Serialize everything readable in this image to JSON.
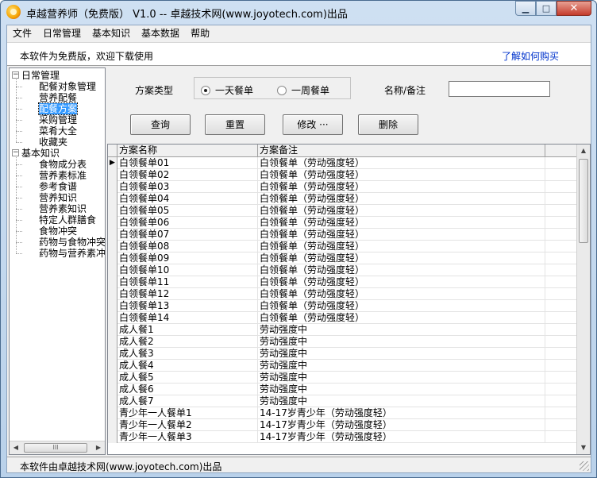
{
  "window": {
    "title": "卓越营养师（免费版） V1.0 -- 卓越技术网(www.joyotech.com)出品"
  },
  "menu": [
    "文件",
    "日常管理",
    "基本知识",
    "基本数据",
    "帮助"
  ],
  "infobar": {
    "left_text": "本软件为免费版，欢迎下载使用",
    "link_text": "了解如何购买"
  },
  "tree": {
    "group1": {
      "label": "日常管理",
      "expander": "−",
      "items": [
        "配餐对象管理",
        "营养配餐",
        "配餐方案",
        "采购管理",
        "菜肴大全",
        "收藏夹"
      ]
    },
    "group2": {
      "label": "基本知识",
      "expander": "−",
      "items": [
        "食物成分表",
        "营养素标准",
        "参考食谱",
        "营养知识",
        "营养素知识",
        "特定人群膳食",
        "食物冲突",
        "药物与食物冲突",
        "药物与营养素冲突"
      ]
    },
    "selected": "配餐方案",
    "hscroll_thumb": "III"
  },
  "form": {
    "plan_type_label": "方案类型",
    "radio_day": "一天餐单",
    "radio_week": "一周餐单",
    "radio_selected": "day",
    "name_label": "名称/备注",
    "name_value": "",
    "buttons": {
      "query": "查询",
      "reset": "重置",
      "edit": "修改 ···",
      "delete": "删除"
    }
  },
  "grid": {
    "columns": [
      "方案名称",
      "方案备注"
    ],
    "current_row_marker": "▶",
    "rows": [
      [
        "白领餐单01",
        "白领餐单（劳动强度轻）"
      ],
      [
        "白领餐单02",
        "白领餐单（劳动强度轻）"
      ],
      [
        "白领餐单03",
        "白领餐单（劳动强度轻）"
      ],
      [
        "白领餐单04",
        "白领餐单（劳动强度轻）"
      ],
      [
        "白领餐单05",
        "白领餐单（劳动强度轻）"
      ],
      [
        "白领餐单06",
        "白领餐单（劳动强度轻）"
      ],
      [
        "白领餐单07",
        "白领餐单（劳动强度轻）"
      ],
      [
        "白领餐单08",
        "白领餐单（劳动强度轻）"
      ],
      [
        "白领餐单09",
        "白领餐单（劳动强度轻）"
      ],
      [
        "白领餐单10",
        "白领餐单（劳动强度轻）"
      ],
      [
        "白领餐单11",
        "白领餐单（劳动强度轻）"
      ],
      [
        "白领餐单12",
        "白领餐单（劳动强度轻）"
      ],
      [
        "白领餐单13",
        "白领餐单（劳动强度轻）"
      ],
      [
        "白领餐单14",
        "白领餐单（劳动强度轻）"
      ],
      [
        "成人餐1",
        "劳动强度中"
      ],
      [
        "成人餐2",
        "劳动强度中"
      ],
      [
        "成人餐3",
        "劳动强度中"
      ],
      [
        "成人餐4",
        "劳动强度中"
      ],
      [
        "成人餐5",
        "劳动强度中"
      ],
      [
        "成人餐6",
        "劳动强度中"
      ],
      [
        "成人餐7",
        "劳动强度中"
      ],
      [
        "青少年一人餐单1",
        "14-17岁青少年（劳动强度轻）"
      ],
      [
        "青少年一人餐单2",
        "14-17岁青少年（劳动强度轻）"
      ],
      [
        "青少年一人餐单3",
        "14-17岁青少年（劳动强度轻）"
      ]
    ]
  },
  "status": {
    "text": "本软件由卓越技术网(www.joyotech.com)出品"
  }
}
